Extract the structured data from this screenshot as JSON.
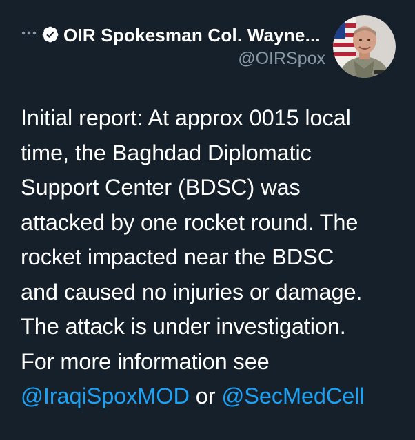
{
  "author": {
    "display_name": "OIR Spokesman Col. Wayne...",
    "handle": "@OIRSpox",
    "verified": true,
    "avatar_icon": "army-officer-portrait-with-us-flag"
  },
  "menu": {
    "icon": "more-horizontal-icon",
    "glyph": "···"
  },
  "tweet": {
    "lines": [
      "Initial report: At approx 0015 local",
      "time, the Baghdad Diplomatic",
      "Support Center (BDSC) was",
      "attacked by one rocket round. The",
      "rocket impacted near the BDSC",
      "and caused no injuries or damage.",
      "The attack is under investigation.",
      "For more information see"
    ],
    "mention_1": "@IraqiSpoxMOD",
    "connector": " or ",
    "mention_2": "@SecMedCell"
  },
  "colors": {
    "background": "#15202b",
    "text": "#ffffff",
    "secondary_text": "#8899a6",
    "link": "#1da1f2"
  }
}
